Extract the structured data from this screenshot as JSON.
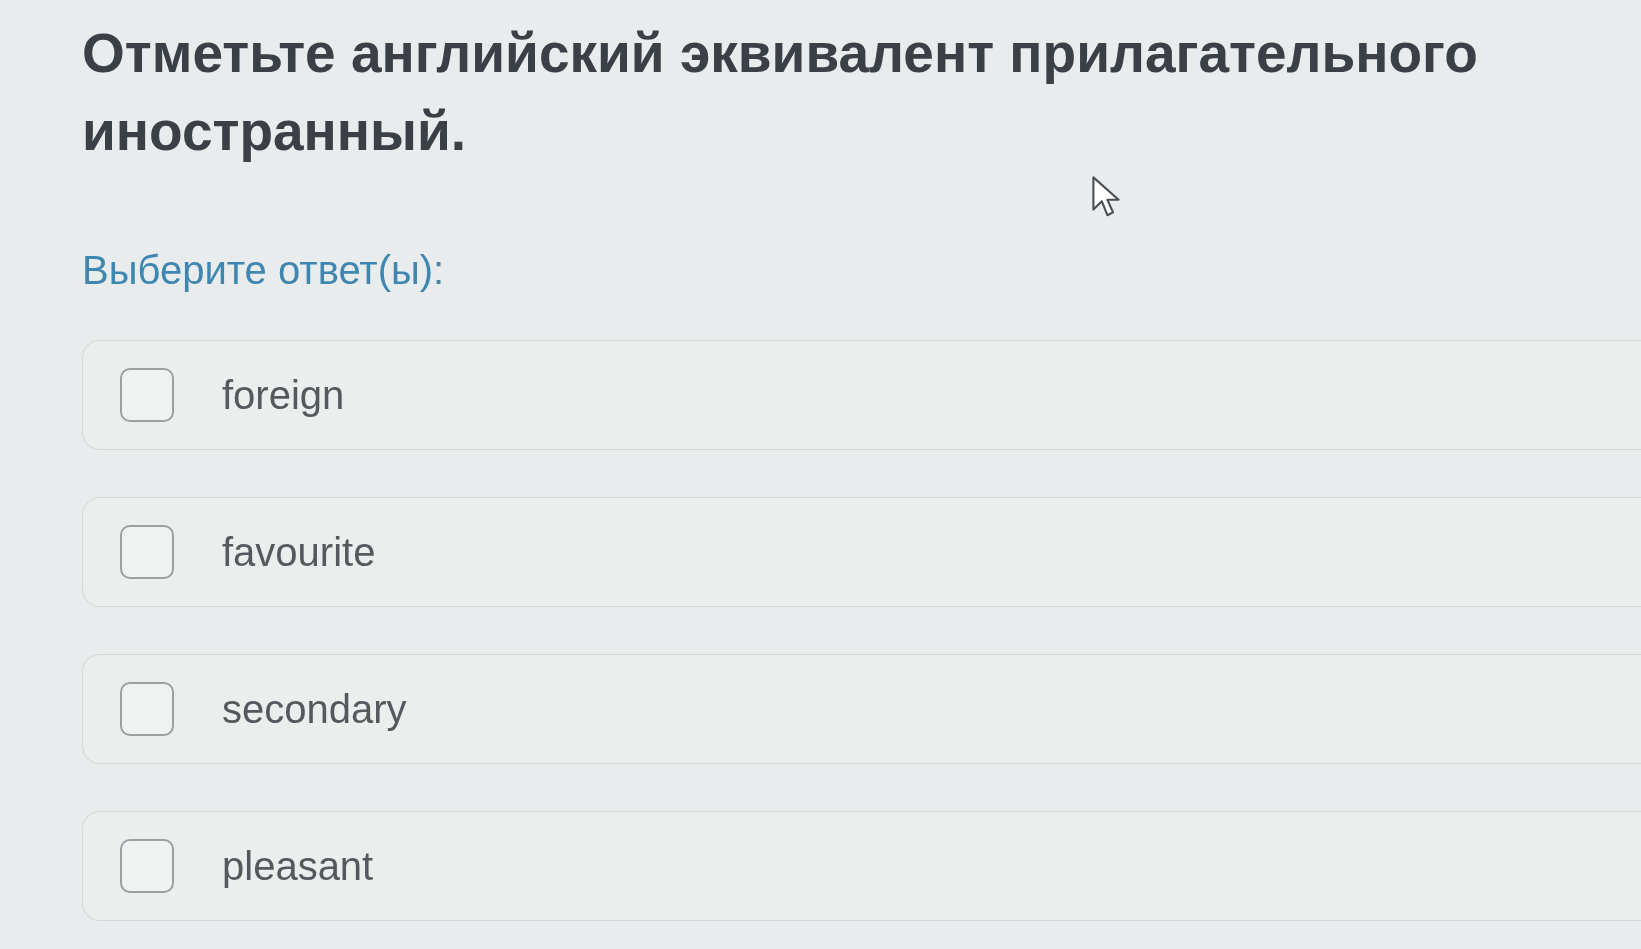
{
  "question": {
    "title": "Отметьте английский эквивалент прилагательного иностранный.",
    "prompt": "Выберите ответ(ы):"
  },
  "options": [
    {
      "label": "foreign",
      "checked": false
    },
    {
      "label": "favourite",
      "checked": false
    },
    {
      "label": "secondary",
      "checked": false
    },
    {
      "label": "pleasant",
      "checked": false
    }
  ]
}
